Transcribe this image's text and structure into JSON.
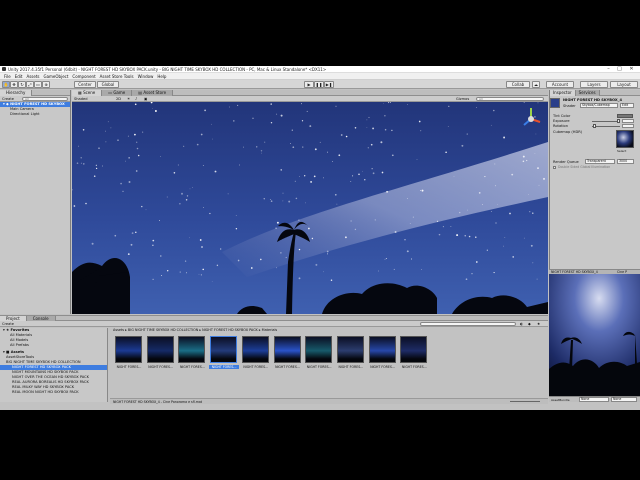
{
  "window": {
    "title": "Unity 2017.4.35f1 Personal (64bit) - NIGHT FOREST HD SKYBOX PACK.unity - BIG NIGHT TIME SKYBOX HD COLLECTION - PC, Mac & Linux Standalone* <DX11>",
    "minimize": "–",
    "maximize": "□",
    "close": "✕"
  },
  "menu": [
    "File",
    "Edit",
    "Assets",
    "GameObject",
    "Component",
    "Asset Store Tools",
    "Window",
    "Help"
  ],
  "toolbar": {
    "pivot": "Center",
    "space": "Global",
    "collab": "Collab",
    "account": "Account",
    "layers": "Layers",
    "layout": "Layout"
  },
  "hierarchy": {
    "tab": "Hierarchy",
    "create": "Create",
    "search_placeholder": "All",
    "scene_name": "NIGHT FOREST HD SKYBOX",
    "items": [
      "Main Camera",
      "Directional Light"
    ]
  },
  "scene_view": {
    "tabs": [
      "Scene",
      "Game",
      "Asset Store"
    ],
    "shading": "Shaded",
    "mode_2d": "2D",
    "gizmos": "Gizmos",
    "search_placeholder": "All"
  },
  "inspector": {
    "tabs": [
      "Inspector",
      "Services"
    ],
    "material_name": "NIGHT FOREST HD SKYBOX_4",
    "shader_label": "Shader",
    "shader_value": "Skybox/Cubemap",
    "props": [
      {
        "label": "Tint Color"
      },
      {
        "label": "Exposure"
      },
      {
        "label": "Rotation"
      },
      {
        "label": "Cubemap  (HDR)"
      }
    ],
    "select_label": "Select",
    "render_queue_label": "Render Queue",
    "render_queue_value": "Transparent",
    "render_queue_number": "3000",
    "double_sided": "Double Sided Global Illumination",
    "preview_title": "NIGHT FOREST HD SKYBOX_4",
    "preview_mode": "Cine P",
    "preview_footer_left": "AssetBundle",
    "preview_footer_mid": "None",
    "preview_footer_right": "None"
  },
  "project": {
    "tabs": [
      "Project",
      "Console"
    ],
    "create": "Create",
    "favorites_label": "Favorites",
    "favorites": [
      "All Materials",
      "All Models",
      "All Prefabs"
    ],
    "assets_label": "Assets",
    "tree": [
      "AssetStoreTools",
      "BIG NIGHT TIME SKYBOX HD COLLECTION",
      "NIGHT FOREST HD SKYBOX PACK",
      "NIGHT MOUNTAINS HD SKYBOX PACK",
      "NIGHT OVER THE OCEAN HD SKYBOX PACK",
      "REAL AURORA BOREALIS HD SKYBOX PACK",
      "REAL MILKY WAY HD SKYBOX PACK",
      "REAL MOON NIGHT HD SKYBOX PACK"
    ],
    "breadcrumb": "Assets ▸ BIG NIGHT TIME SKYBOX HD COLLECTION ▸ NIGHT FOREST HD SKYBOX PACK ▸ Materials",
    "thumb_labels": [
      "NIGHT FORES...",
      "NIGHT FORES...",
      "NIGHT FORES...",
      "NIGHT FORES...",
      "NIGHT FORES...",
      "NIGHT FORES...",
      "NIGHT FORES...",
      "NIGHT FORES...",
      "NIGHT FORES...",
      "NIGHT FORES..."
    ],
    "status": "NIGHT FOREST HD SKYBOX_4 - Cine Panorama e sfl.mat"
  },
  "colors": {
    "selection": "#3e7de0",
    "editor_bg": "#c2c2c2",
    "sky": "#283e87"
  }
}
